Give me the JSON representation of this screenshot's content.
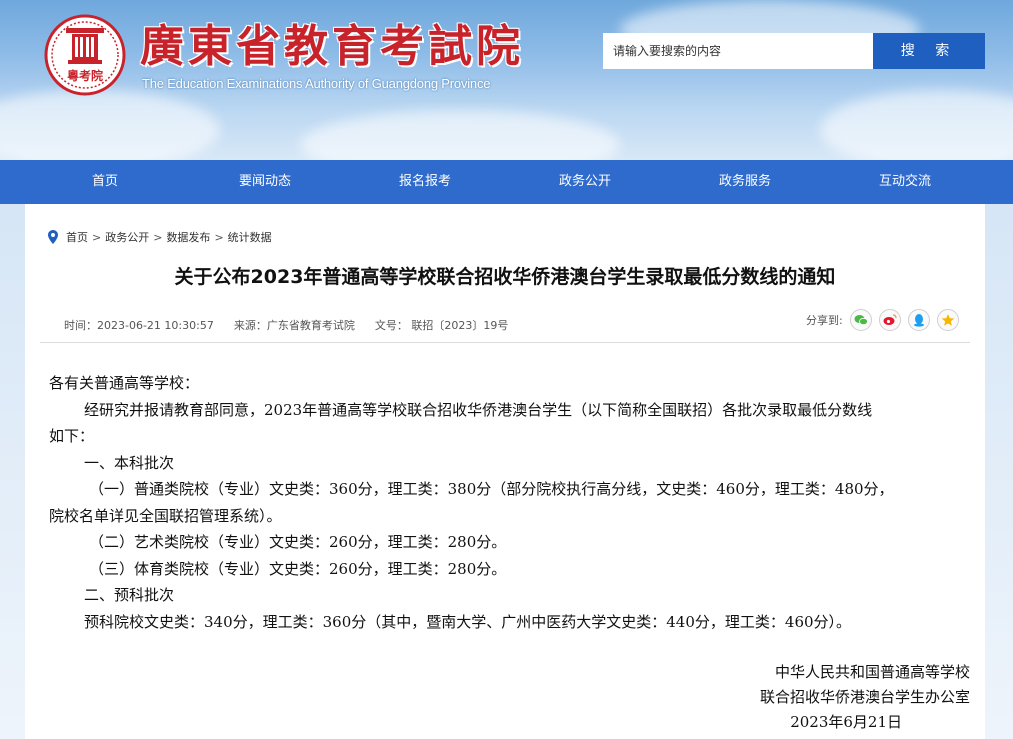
{
  "header": {
    "org_name_cn": "廣東省教育考試院",
    "org_name_en": "The Education Examinations Authority of Guangdong Province",
    "seal_text": "粵考院",
    "search": {
      "placeholder": "请输入要搜索的内容",
      "button_label": "搜 索"
    }
  },
  "nav": {
    "items": [
      {
        "label": "首页"
      },
      {
        "label": "要闻动态"
      },
      {
        "label": "报名报考"
      },
      {
        "label": "政务公开"
      },
      {
        "label": "政务服务"
      },
      {
        "label": "互动交流"
      }
    ]
  },
  "breadcrumb": {
    "items": [
      "首页",
      "政务公开",
      "数据发布",
      "统计数据"
    ],
    "separator": ">"
  },
  "article": {
    "title": "关于公布2023年普通高等学校联合招收华侨港澳台学生录取最低分数线的通知",
    "meta": {
      "time": "时间：2023-06-21 10:30:57",
      "source": "来源：广东省教育考试院",
      "doc_no": "文号： 联招〔2023〕19号"
    },
    "share_label": "分享到:",
    "share_icons": [
      "wechat-icon",
      "weibo-icon",
      "qq-icon",
      "qzone-icon"
    ],
    "paragraphs": {
      "salutation": "各有关普通高等学校：",
      "p1_line1": "经研究并报请教育部同意，2023年普通高等学校联合招收华侨港澳台学生（以下简称全国联招）各批次录取最低分数线",
      "p1_line2": "如下：",
      "h1": "一、本科批次",
      "i1_line1": "（一）普通类院校（专业）文史类：360分，理工类：380分（部分院校执行高分线，文史类：460分，理工类：480分，",
      "i1_line2": "院校名单详见全国联招管理系统）。",
      "i2": "（二）艺术类院校（专业）文史类：260分，理工类：280分。",
      "i3": "（三）体育类院校（专业）文史类：260分，理工类：280分。",
      "h2": "二、预科批次",
      "p2": "预科院校文史类：340分，理工类：360分（其中，暨南大学、广州中医药大学文史类：440分，理工类：460分）。"
    },
    "signature": {
      "line1": "中华人民共和国普通高等学校",
      "line2": "联合招收华侨港澳台学生办公室",
      "date": "2023年6月21日"
    }
  },
  "colors": {
    "nav_bg": "#2f6bcc",
    "search_button": "#1f5fbf",
    "brand_red": "#c8232a"
  }
}
